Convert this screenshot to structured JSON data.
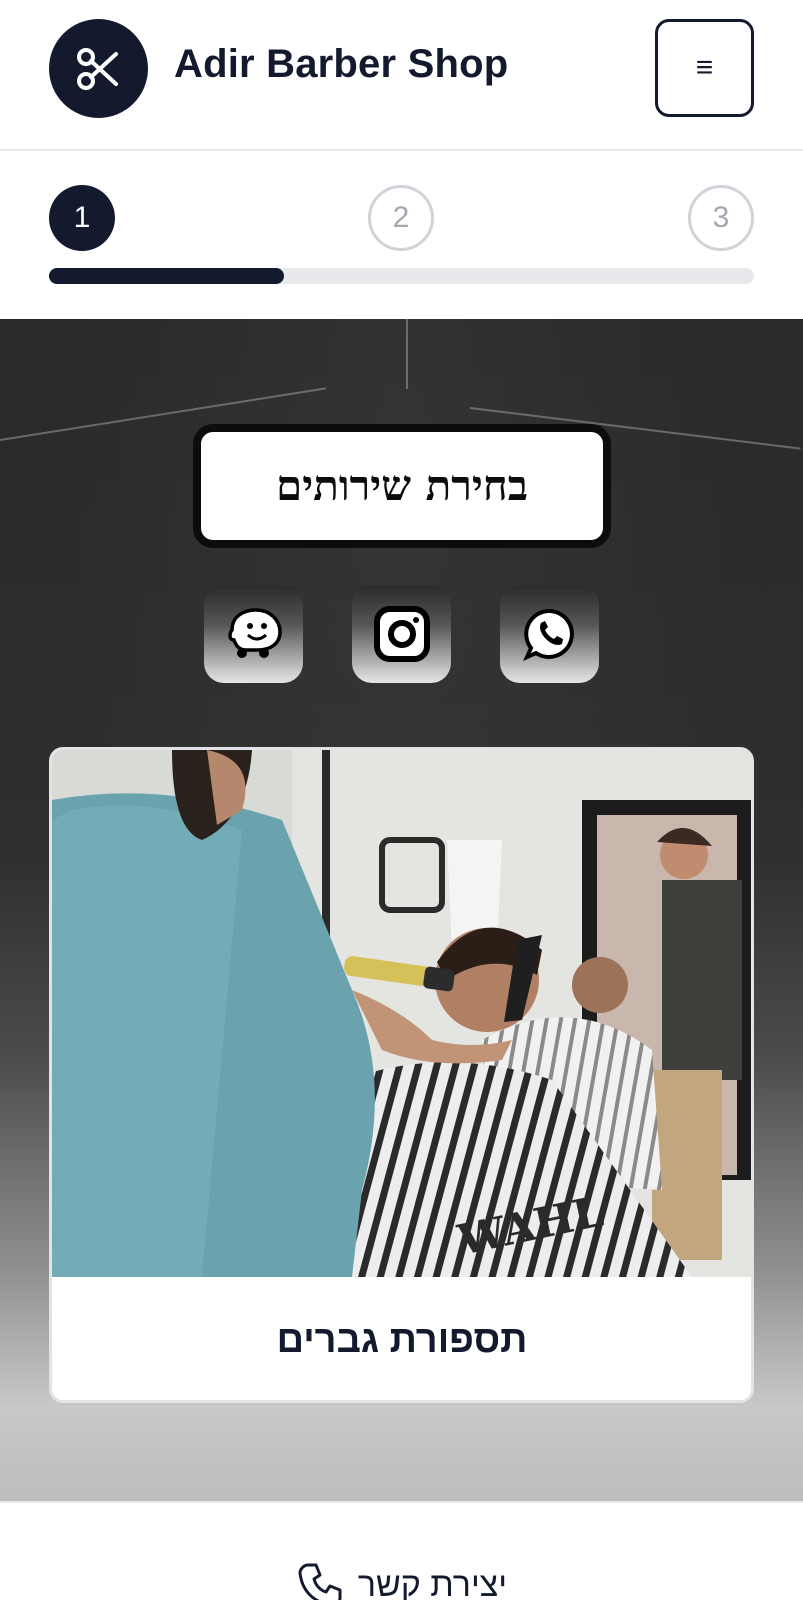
{
  "header": {
    "brand": "Adir Barber Shop",
    "logo_icon": "scissors-icon",
    "menu_icon": "hamburger-menu-icon",
    "menu_glyph": "≡"
  },
  "stepper": {
    "steps": [
      {
        "label": "1",
        "state": "active"
      },
      {
        "label": "2",
        "state": "inactive"
      },
      {
        "label": "3",
        "state": "inactive"
      }
    ],
    "progress": 0.333
  },
  "hero": {
    "title": "בחירת שירותים",
    "social": [
      {
        "name": "waze",
        "icon": "waze-icon"
      },
      {
        "name": "instagram",
        "icon": "instagram-icon"
      },
      {
        "name": "whatsapp",
        "icon": "whatsapp-icon"
      }
    ]
  },
  "services": [
    {
      "label": "תספורת גברים",
      "image": "barber-haircut-photo",
      "apron_text": "WAHL"
    }
  ],
  "footer": {
    "contact_label": "יצירת קשר",
    "contact_icon": "phone-icon"
  },
  "colors": {
    "primary": "#141a2e",
    "progress_track": "#e8e9ed",
    "inactive_step": "#a3a7b1"
  }
}
